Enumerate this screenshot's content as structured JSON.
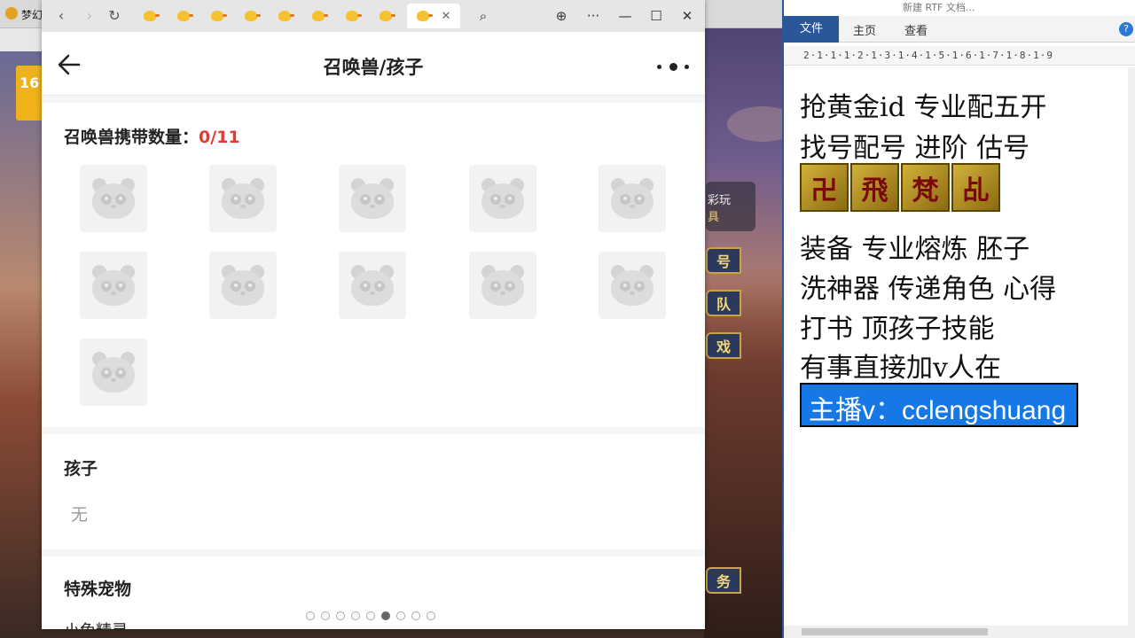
{
  "game": {
    "title": "梦幻",
    "badge": "16",
    "panel_text": "彩玩",
    "panel_sub": "具",
    "side_buttons": [
      "号",
      "队",
      "戏",
      "务"
    ]
  },
  "browser": {
    "nav": {
      "back": "‹",
      "forward": "›",
      "refresh": "↻"
    },
    "tab_count": 9,
    "active_tab_close": "✕",
    "search_icon": "⌕",
    "globe_icon": "⊕",
    "more": "···",
    "minimize": "—",
    "maximize": "☐",
    "close": "✕"
  },
  "app": {
    "title": "召唤兽/孩子",
    "pet_section": {
      "label": "召唤兽携带数量：",
      "count": "0/11",
      "slots": 11
    },
    "kids_section": {
      "title": "孩子",
      "value": "无"
    },
    "special_section": {
      "title": "特殊宠物",
      "item_preview": "小兔精灵"
    },
    "page_indicator": {
      "total": 9,
      "active_index": 5
    }
  },
  "word": {
    "title": "新建 RTF 文档...",
    "tabs": {
      "file": "文件",
      "home": "主页",
      "view": "查看"
    },
    "help": "?",
    "ruler": "2·1·1·1·2·1·3·1·4·1·5·1·6·1·7·1·8·1·9",
    "lines": [
      "抢黄金id 专业配五开",
      "找号配号 进阶 估号",
      "装备 专业熔炼 胚子",
      "洗神器 传递角色 心得",
      "打书 顶孩子技能",
      "有事直接加v人在"
    ],
    "seals": [
      "卍",
      "飛",
      "梵",
      "乩"
    ],
    "highlight": "主播v：cclengshuang"
  }
}
